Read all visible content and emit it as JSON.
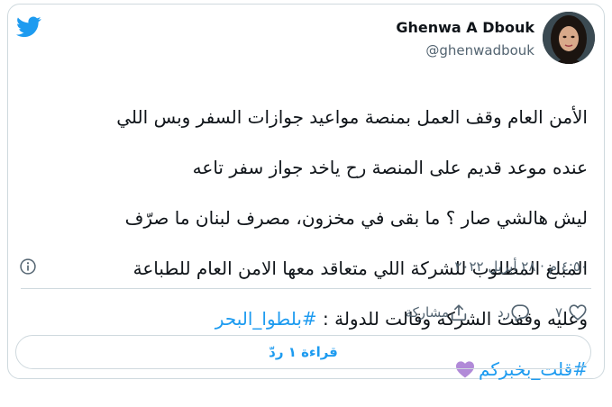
{
  "author": {
    "name": "Ghenwa A Dbouk",
    "handle": "@ghenwadbouk"
  },
  "tweet": {
    "lines": [
      "الأمن العام وقف العمل بمنصة مواعيد جوازات السفر وبس اللي",
      "عنده موعد قديم على المنصة رح ياخد جواز سفر تاعه",
      "ليش هالشي صار ؟ ما بقى في مخزون، مصرف لبنان ما صرّف",
      "المبلغ المطلوب للشركة اللي متعاقد معها الامن العام للطباعة",
      "وعليه وقفت الشركة وقالت للدولة :"
    ],
    "hashtag1": "#بلطوا_البحر",
    "hashtag2": "#قلت_بخبركم",
    "emoji": "purple-heart"
  },
  "timestamp": "٤:٥٠ م · ٢٨ أبريل ٢٠٢٢",
  "actions": {
    "like_count": "٧",
    "reply_label": "رد",
    "share_label": "مشاركة"
  },
  "replies_button": "قراءة ١ ردّ",
  "colors": {
    "accent": "#1d9bf0",
    "secondary_text": "#536471",
    "border": "#cfd9de",
    "heart": "#b18ad8"
  }
}
